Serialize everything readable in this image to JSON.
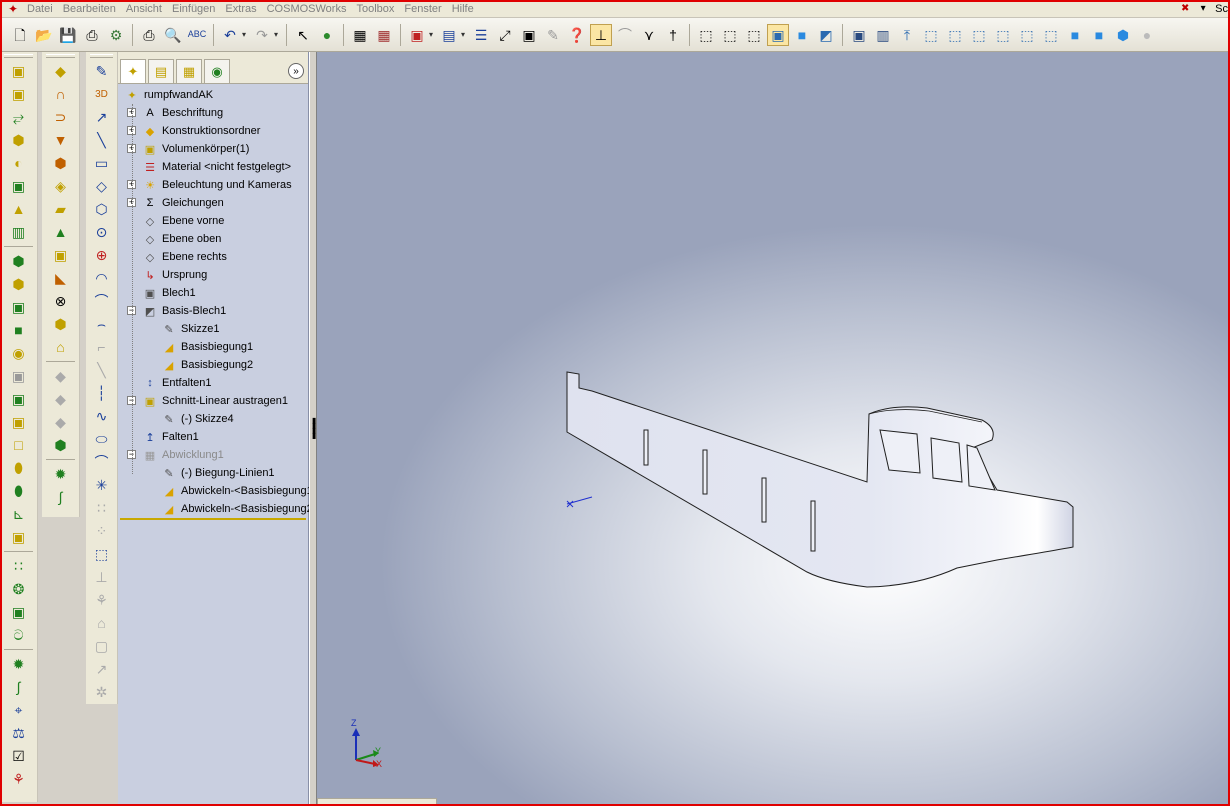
{
  "app": {
    "name": "SolidWorks",
    "right_label": "Sc"
  },
  "menu": {
    "items": [
      "Datei",
      "Bearbeiten",
      "Ansicht",
      "Einfügen",
      "Extras",
      "COSMOSWorks",
      "Toolbox",
      "Fenster",
      "Hilfe"
    ]
  },
  "toolbar": {
    "icons": [
      "new-document-icon",
      "open-icon",
      "save-icon",
      "print-icon",
      "print-preview-icon",
      "spell-check-icon",
      "undo-icon",
      "redo-icon",
      "select-icon",
      "rebuild-icon",
      "grid-icon",
      "options-icon",
      "view-orientation-icon",
      "display-pane-icon",
      "zoom-fit-icon",
      "zoom-area-icon",
      "rotate-icon",
      "help-icon",
      "shadow-icon",
      "section-view-icon",
      "curvature-icon",
      "lights-icon",
      "toolbox-icon",
      "wireframe-icon",
      "hidden-lines-visible-icon",
      "hidden-lines-removed-icon",
      "shaded-edges-icon",
      "shaded-icon",
      "perspective-icon",
      "front-view-icon",
      "back-view-icon",
      "left-view-icon",
      "right-view-icon",
      "top-view-icon",
      "bottom-view-icon",
      "isometric-view-icon",
      "trimetric-view-icon",
      "dimetric-view-icon",
      "normal-to-icon",
      "view-one-icon",
      "view-two-icon",
      "view-four-icon",
      "status-icon"
    ]
  },
  "feature_manager": {
    "tabs": [
      "feature-tree-tab",
      "property-tab",
      "configuration-tab",
      "cosmos-tab"
    ],
    "tree": [
      {
        "label": "rumpfwandAK",
        "icon": "part-icon",
        "level": 0,
        "expander": "",
        "greyed": false
      },
      {
        "label": "Beschriftung",
        "icon": "annotation-icon",
        "level": 1,
        "expander": "+",
        "greyed": false
      },
      {
        "label": "Konstruktionsordner",
        "icon": "design-folder-icon",
        "level": 1,
        "expander": "+",
        "greyed": false
      },
      {
        "label": "Volumenkörper(1)",
        "icon": "solid-bodies-icon",
        "level": 1,
        "expander": "+",
        "greyed": false
      },
      {
        "label": "Material <nicht festgelegt>",
        "icon": "material-icon",
        "level": 1,
        "expander": "",
        "greyed": false
      },
      {
        "label": "Beleuchtung und Kameras",
        "icon": "lighting-icon",
        "level": 1,
        "expander": "+",
        "greyed": false
      },
      {
        "label": "Gleichungen",
        "icon": "equations-icon",
        "level": 1,
        "expander": "+",
        "greyed": false
      },
      {
        "label": "Ebene vorne",
        "icon": "plane-icon",
        "level": 1,
        "expander": "",
        "greyed": false
      },
      {
        "label": "Ebene oben",
        "icon": "plane-icon",
        "level": 1,
        "expander": "",
        "greyed": false
      },
      {
        "label": "Ebene rechts",
        "icon": "plane-icon",
        "level": 1,
        "expander": "",
        "greyed": false
      },
      {
        "label": "Ursprung",
        "icon": "origin-icon",
        "level": 1,
        "expander": "",
        "greyed": false
      },
      {
        "label": "Blech1",
        "icon": "sheet-metal-icon",
        "level": 1,
        "expander": "",
        "greyed": false
      },
      {
        "label": "Basis-Blech1",
        "icon": "base-flange-icon",
        "level": 1,
        "expander": "-",
        "greyed": false
      },
      {
        "label": "Skizze1",
        "icon": "sketch-icon",
        "level": 2,
        "expander": "",
        "greyed": false
      },
      {
        "label": "Basisbiegung1",
        "icon": "bend-icon",
        "level": 2,
        "expander": "",
        "greyed": false
      },
      {
        "label": "Basisbiegung2",
        "icon": "bend-icon",
        "level": 2,
        "expander": "",
        "greyed": false
      },
      {
        "label": "Entfalten1",
        "icon": "unfold-icon",
        "level": 1,
        "expander": "",
        "greyed": false
      },
      {
        "label": "Schnitt-Linear austragen1",
        "icon": "extruded-cut-icon",
        "level": 1,
        "expander": "-",
        "greyed": false
      },
      {
        "label": "(-) Skizze4",
        "icon": "sketch-icon",
        "level": 2,
        "expander": "",
        "greyed": false
      },
      {
        "label": "Falten1",
        "icon": "fold-icon",
        "level": 1,
        "expander": "",
        "greyed": false
      },
      {
        "label": "Abwicklung1",
        "icon": "flat-pattern-icon",
        "level": 1,
        "expander": "-",
        "greyed": true
      },
      {
        "label": "(-) Biegung-Linien1",
        "icon": "sketch-icon",
        "level": 2,
        "expander": "",
        "greyed": false
      },
      {
        "label": "Abwickeln-<Basisbiegung1",
        "icon": "bend-icon",
        "level": 2,
        "expander": "",
        "greyed": false
      },
      {
        "label": "Abwickeln-<Basisbiegung2",
        "icon": "bend-icon",
        "level": 2,
        "expander": "",
        "greyed": false
      }
    ]
  },
  "triad": {
    "x": "X",
    "y": "Y",
    "z": "Z"
  },
  "colors": {
    "frame": "#e00000",
    "viewport_bg": "#b8bfd0",
    "part": "#dfe2ef",
    "tree_bg": "#c9cfe0"
  }
}
